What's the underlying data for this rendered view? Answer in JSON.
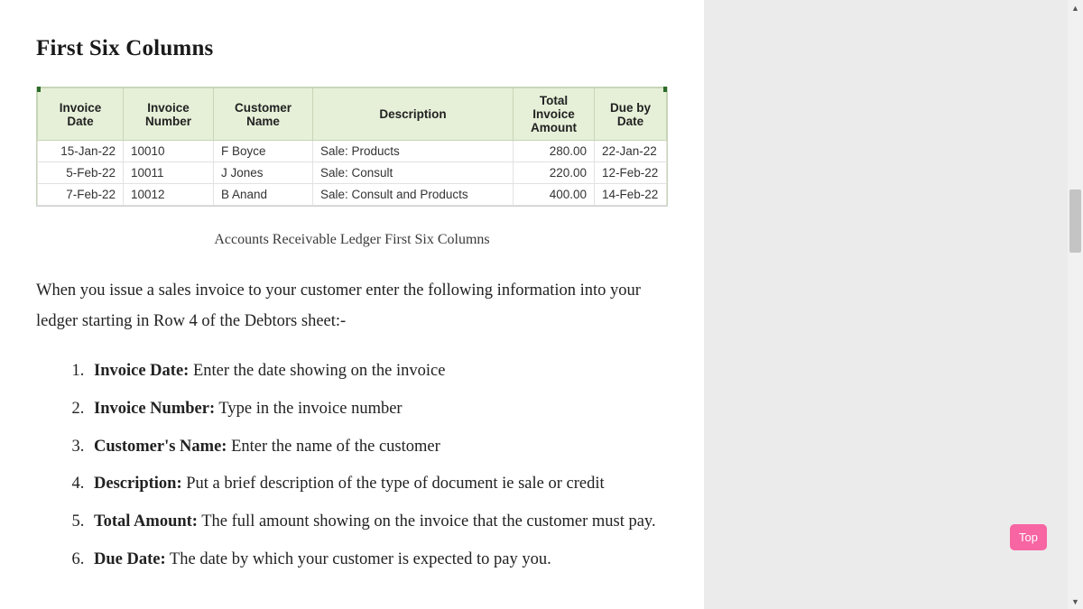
{
  "heading": "First Six Columns",
  "table": {
    "headers": [
      "Invoice Date",
      "Invoice Number",
      "Customer Name",
      "Description",
      "Total Invoice Amount",
      "Due by Date"
    ],
    "rows": [
      {
        "date": "15-Jan-22",
        "num": "10010",
        "cust": "F Boyce",
        "desc": "Sale: Products",
        "amt": "280.00",
        "due": "22-Jan-22"
      },
      {
        "date": "5-Feb-22",
        "num": "10011",
        "cust": "J Jones",
        "desc": "Sale: Consult",
        "amt": "220.00",
        "due": "12-Feb-22"
      },
      {
        "date": "7-Feb-22",
        "num": "10012",
        "cust": "B Anand",
        "desc": "Sale: Consult and Products",
        "amt": "400.00",
        "due": "14-Feb-22"
      }
    ]
  },
  "caption": "Accounts Receivable Ledger First Six Columns",
  "intro": "When you issue a sales invoice to your customer enter the following information into your ledger starting in Row 4 of the Debtors sheet:-",
  "fields": [
    {
      "label": "Invoice Date:",
      "text": " Enter the date showing on the invoice"
    },
    {
      "label": "Invoice Number:",
      "text": " Type in the invoice number"
    },
    {
      "label": "Customer's Name:",
      "text": " Enter the name of the customer"
    },
    {
      "label": "Description:",
      "text": " Put a brief description of the type of document ie sale or credit"
    },
    {
      "label": "Total Amount:",
      "text": " The full amount showing on the invoice that the customer must pay."
    },
    {
      "label": "Due Date:",
      "text": " The date by which your customer is expected to pay you."
    }
  ],
  "top_button": "Top"
}
